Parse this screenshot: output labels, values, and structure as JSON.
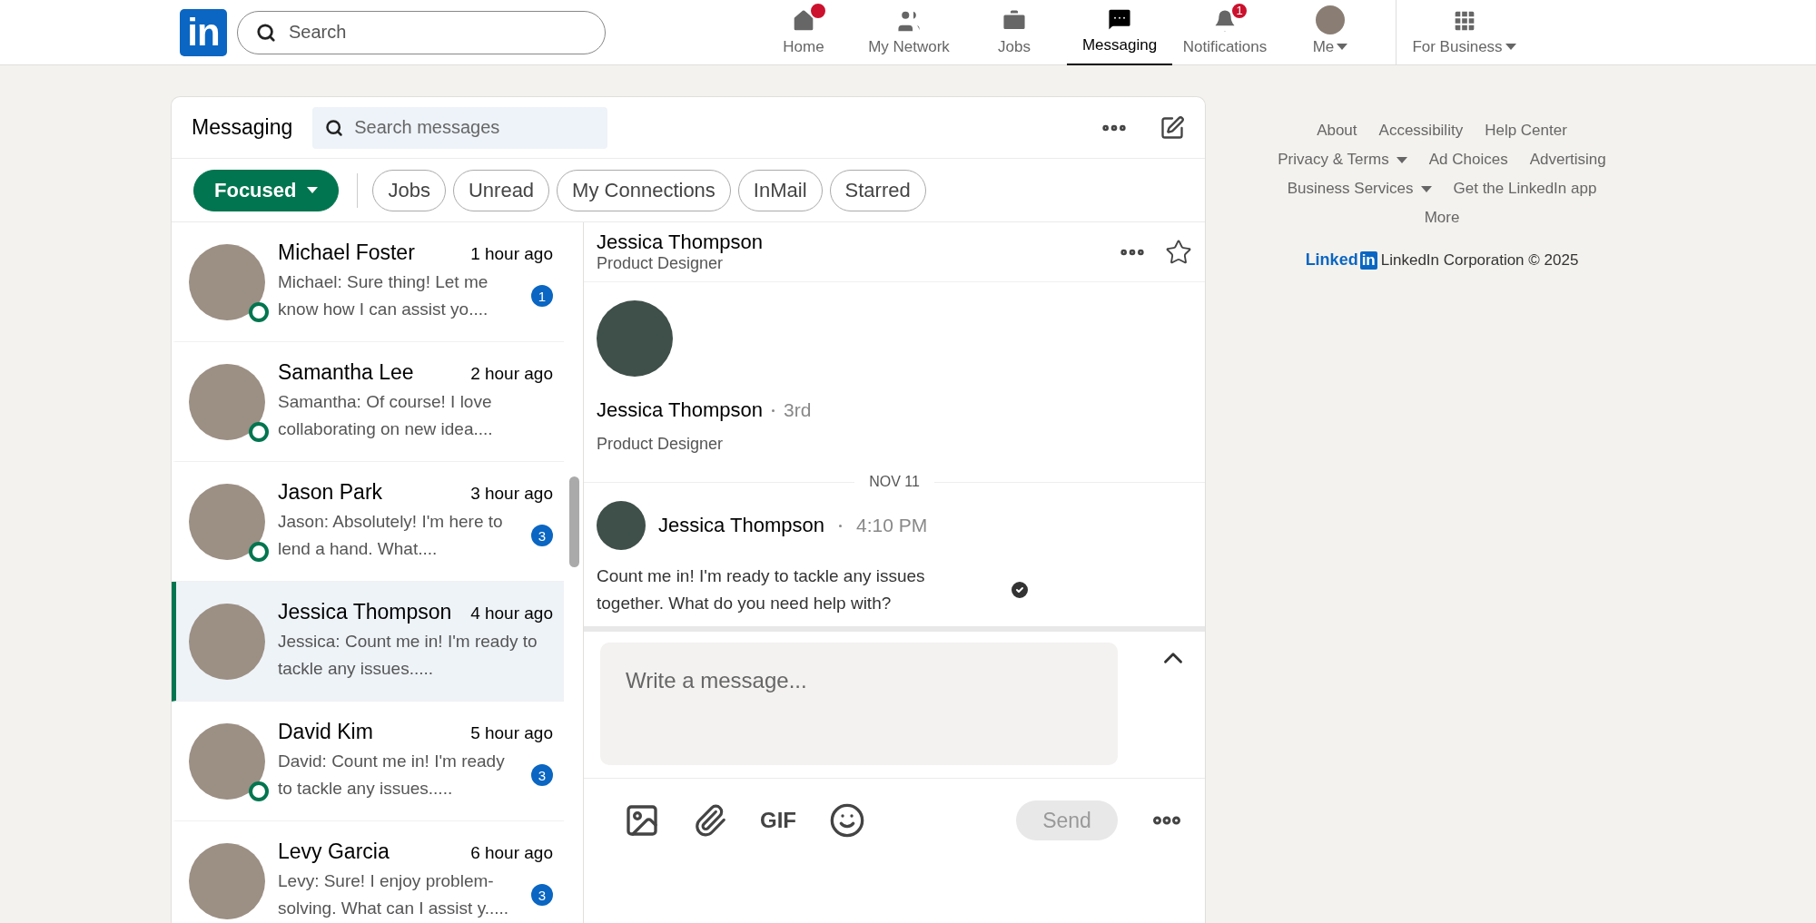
{
  "header": {
    "logo": "in",
    "search": {
      "placeholder": "Search"
    },
    "nav": [
      {
        "kind": "home",
        "label": "Home",
        "selected": false,
        "dot": true
      },
      {
        "kind": "network",
        "label": "My Network",
        "selected": false,
        "dot": false
      },
      {
        "kind": "jobs",
        "label": "Jobs",
        "selected": false,
        "dot": false
      },
      {
        "kind": "messaging",
        "label": "Messaging",
        "selected": true,
        "dot": false
      },
      {
        "kind": "notifications",
        "label": "Notifications",
        "selected": false,
        "dot": false,
        "count": "1"
      },
      {
        "kind": "me",
        "label": "Me",
        "selected": false,
        "dot": false
      },
      {
        "kind": "business",
        "label": "For Business",
        "selected": false,
        "dot": false
      }
    ]
  },
  "messaging": {
    "title": "Messaging",
    "search": {
      "placeholder": "Search messages"
    },
    "filters": [
      {
        "label": "Focused",
        "selected": true,
        "kind": "dropdown"
      },
      {
        "label": "Jobs",
        "selected": false,
        "kind": "pill"
      },
      {
        "label": "Unread",
        "selected": false,
        "kind": "pill"
      },
      {
        "label": "My Connections",
        "selected": false,
        "kind": "pill"
      },
      {
        "label": "InMail",
        "selected": false,
        "kind": "pill"
      },
      {
        "label": "Starred",
        "selected": false,
        "kind": "pill"
      }
    ],
    "conversations": [
      {
        "name": "Michael Foster",
        "time": "1 hour ago",
        "preview": "Michael: Sure thing! Let me know how I can assist yo....",
        "unread": "1",
        "online": true,
        "selected": false
      },
      {
        "name": "Samantha Lee",
        "time": "2 hour ago",
        "preview": "Samantha: Of course! I love collaborating on new idea....",
        "online": true,
        "selected": false
      },
      {
        "name": "Jason Park",
        "time": "3 hour ago",
        "preview": "Jason: Absolutely! I'm here to lend a hand. What....",
        "unread": "3",
        "online": true,
        "selected": false
      },
      {
        "name": "Jessica Thompson",
        "time": "4 hour ago",
        "preview": "Jessica: Count me in! I'm ready to tackle any issues.....",
        "online": false,
        "selected": true
      },
      {
        "name": "David Kim",
        "time": "5 hour ago",
        "preview": "David: Count me in! I'm ready to tackle any issues.....",
        "unread": "3",
        "online": true,
        "selected": false
      },
      {
        "name": "Levy Garcia",
        "time": "6 hour ago",
        "preview": "Levy: Sure! I enjoy problem-solving. What can I assist y.....",
        "unread": "3",
        "online": false,
        "selected": false
      }
    ],
    "thread": {
      "name": "Jessica Thompson",
      "headline": "Product Designer",
      "starred": false,
      "profile": {
        "name": "Jessica Thompson",
        "degree": "3rd",
        "headline": "Product Designer"
      },
      "date": "NOV 11",
      "message": {
        "sender": "Jessica Thompson",
        "time": "4:10 PM",
        "text": "Count me in! I'm ready to tackle any issues together. What do you need help with?",
        "read": true
      },
      "composer": {
        "placeholder": "Write a message...",
        "gif": "GIF",
        "send": {
          "label": "Send",
          "disabled": true
        }
      }
    }
  },
  "footer": {
    "rows": [
      {
        "links": [
          {
            "label": "About",
            "dropdown": false
          },
          {
            "label": "Accessibility",
            "dropdown": false
          },
          {
            "label": "Help Center",
            "dropdown": false
          }
        ]
      },
      {
        "links": [
          {
            "label": "Privacy & Terms",
            "dropdown": true
          },
          {
            "label": "Ad Choices",
            "dropdown": false
          },
          {
            "label": "Advertising",
            "dropdown": false
          }
        ]
      },
      {
        "links": [
          {
            "label": "Business Services",
            "dropdown": true
          },
          {
            "label": "Get the LinkedIn app",
            "dropdown": false
          }
        ]
      },
      {
        "links": [
          {
            "label": "More",
            "dropdown": false
          }
        ]
      }
    ],
    "brand": "Linked",
    "brand_mark": "in",
    "copyright": "LinkedIn Corporation © 2025"
  }
}
